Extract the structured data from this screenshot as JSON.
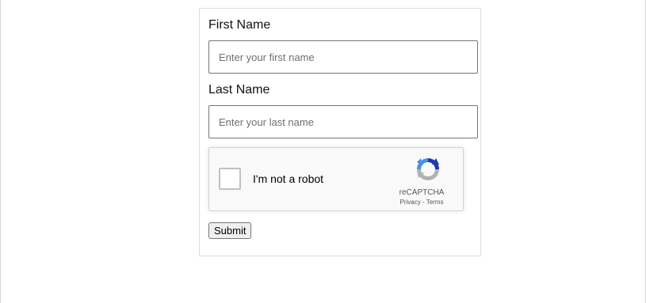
{
  "form": {
    "first_name": {
      "label": "First Name",
      "value": "",
      "placeholder": "Enter your first name"
    },
    "last_name": {
      "label": "Last Name",
      "value": "",
      "placeholder": "Enter your last name"
    },
    "captcha": {
      "label": "I'm not a robot",
      "checked": false,
      "brand": "reCAPTCHA",
      "privacy_link": "Privacy",
      "separator": " - ",
      "terms_link": "Terms",
      "logo_icon": "recaptcha-logo-icon"
    },
    "submit_label": "Submit"
  },
  "colors": {
    "input_border": "#767676",
    "captcha_bg": "#f9f9f9",
    "captcha_logo_blue": "#1c3aa9",
    "captcha_logo_light": "#4a90e2",
    "captcha_logo_gray": "#b1b1b1"
  }
}
